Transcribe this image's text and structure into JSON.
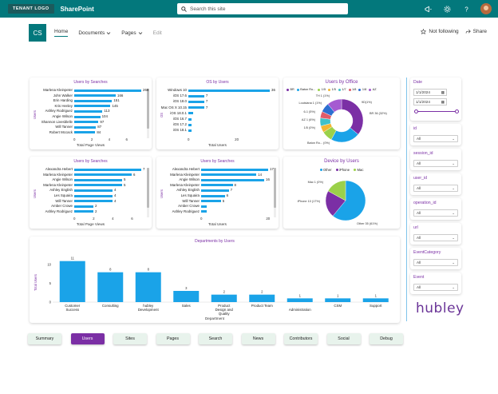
{
  "suite": {
    "tenant_logo": "TENANT LOGO",
    "app_name": "SharePoint",
    "search_placeholder": "Search this site"
  },
  "site": {
    "logo_initials": "CS",
    "nav": [
      "Home",
      "Documents",
      "Pages",
      "Edit"
    ],
    "not_following": "Not following",
    "share": "Share"
  },
  "card1": {
    "title": "Users by Searches",
    "y_title": "Users",
    "x_title": "Total Page Views",
    "ticks": [
      "0",
      "2",
      "4",
      "6"
    ],
    "rows": [
      {
        "label": "Marlena Kleinpeter",
        "value": "268",
        "v": 268
      },
      {
        "label": "John Walker",
        "value": "166",
        "v": 166
      },
      {
        "label": "Erin Harding",
        "value": "151",
        "v": 151
      },
      {
        "label": "Kris Henley",
        "value": "145",
        "v": 145
      },
      {
        "label": "Ashley Rodriguez",
        "value": "113",
        "v": 113
      },
      {
        "label": "Angie Wilson",
        "value": "104",
        "v": 104
      },
      {
        "label": "Shannon Livesblelle",
        "value": "97",
        "v": 97
      },
      {
        "label": "Will Tanner",
        "value": "87",
        "v": 87
      },
      {
        "label": "Robert Mccack",
        "value": "84",
        "v": 84
      }
    ]
  },
  "card2": {
    "title": "OS by Users",
    "y_title": "OS",
    "x_title": "Total Users",
    "ticks": [
      "0",
      "20"
    ],
    "rows": [
      {
        "label": "Windows 10",
        "value": "36",
        "v": 36
      },
      {
        "label": "iOS 17.6",
        "value": "7",
        "v": 7
      },
      {
        "label": "iOS 18.0",
        "value": "7",
        "v": 7
      },
      {
        "label": "Mac OS X 10.15",
        "value": "7",
        "v": 7
      },
      {
        "label": "iOS 18.0.1",
        "value": "",
        "v": 2
      },
      {
        "label": "iOS 16.7",
        "value": "",
        "v": 1.5
      },
      {
        "label": "iOS 17.2",
        "value": "",
        "v": 1.5
      },
      {
        "label": "iOS 18.1",
        "value": "",
        "v": 1.5
      }
    ]
  },
  "card3": {
    "title": "Users by Office",
    "legend": [
      "BR",
      "Baton Ro...",
      "1/5",
      "1/5",
      "1/7",
      "1/8",
      "1/8",
      "AZ"
    ],
    "legend_colors": [
      "#7b2fa5",
      "#1aa3e8",
      "#9bd14a",
      "#f2b632",
      "#3fc1c9",
      "#e05b6a",
      "#2d6fd1",
      "#a55bd1"
    ],
    "labels": [
      "TH 1 (1%)",
      "Louisiana 1 (1%)",
      "6-1 (5%)",
      "AZ 1 (6%)",
      "1/5 (0%)",
      "BR 36 (32%)",
      "Baton Ro... (0%)",
      "9D(1%)"
    ],
    "slices": [
      {
        "name": "BR",
        "v": 36,
        "color": "#7b2fa5"
      },
      {
        "name": "Baton Ro...",
        "v": 22,
        "color": "#1aa3e8"
      },
      {
        "name": "1/5",
        "v": 8,
        "color": "#9bd14a"
      },
      {
        "name": "1/5",
        "v": 5,
        "color": "#f2b632"
      },
      {
        "name": "1/7",
        "v": 6,
        "color": "#3fc1c9"
      },
      {
        "name": "1/8",
        "v": 5,
        "color": "#e05b6a"
      },
      {
        "name": "1/8",
        "v": 7,
        "color": "#2d6fd1"
      },
      {
        "name": "AZ",
        "v": 11,
        "color": "#a55bd1"
      }
    ]
  },
  "card4": {
    "title": "Users by Searches",
    "y_title": "Users",
    "x_title": "Total Page Views",
    "ticks": [
      "0",
      "2",
      "4",
      "6"
    ],
    "rows": [
      {
        "label": "Alexandra Hebert",
        "value": "7",
        "v": 7
      },
      {
        "label": "Marlena Kleinpeter",
        "value": "6",
        "v": 6
      },
      {
        "label": "Angie Wilson",
        "value": "5",
        "v": 5
      },
      {
        "label": "Marlena Kleinpeter",
        "value": "5",
        "v": 5
      },
      {
        "label": "Ashley English",
        "value": "4",
        "v": 4
      },
      {
        "label": "Les Squaira",
        "value": "4",
        "v": 4
      },
      {
        "label": "Will Tanner",
        "value": "4",
        "v": 4
      },
      {
        "label": "Amber Crowe",
        "value": "2",
        "v": 2
      },
      {
        "label": "Ashley Rodriguez",
        "value": "2",
        "v": 2
      }
    ]
  },
  "card5": {
    "title": "Users by Searches",
    "y_title": "Users",
    "x_title": "Total Users",
    "ticks": [
      "0",
      "20"
    ],
    "rows": [
      {
        "label": "Alexandra Hebert",
        "value": "17",
        "v": 17
      },
      {
        "label": "Marlena Kleinpeter",
        "value": "14",
        "v": 14
      },
      {
        "label": "Angie Wilson",
        "value": "16",
        "v": 16
      },
      {
        "label": "Marlena Kleinpeter",
        "value": "8",
        "v": 8
      },
      {
        "label": "Ashley English",
        "value": "7",
        "v": 7
      },
      {
        "label": "Les Squaira",
        "value": "6",
        "v": 6
      },
      {
        "label": "Will Tanner",
        "value": "5",
        "v": 5
      },
      {
        "label": "Amber Crowe",
        "value": "",
        "v": 1.5
      },
      {
        "label": "Ashley Rodriguez",
        "value": "",
        "v": 1.5
      }
    ]
  },
  "card6": {
    "title": "Device by Users",
    "legend": [
      "Other",
      "iPhone",
      "Mac"
    ],
    "legend_colors": [
      "#1aa3e8",
      "#7b2fa5",
      "#9bd14a"
    ],
    "labels": [
      "Mac 1 (0%)",
      "iPhone 10 (17%)",
      "Other 35 (61%)"
    ],
    "slices": [
      {
        "name": "Other",
        "v": 61,
        "color": "#1aa3e8"
      },
      {
        "name": "iPhone",
        "v": 22,
        "color": "#7b2fa5"
      },
      {
        "name": "Mac",
        "v": 17,
        "color": "#9bd14a"
      }
    ]
  },
  "card7": {
    "title": "Departments by Users",
    "y_title": "Total Users",
    "x_title": "Department",
    "ticks": [
      "0",
      "5",
      "10"
    ],
    "bars": [
      {
        "label": "Customer Success",
        "value": "11",
        "v": 11
      },
      {
        "label": "Consulting",
        "value": "8",
        "v": 8
      },
      {
        "label": "hubley Development",
        "value": "8",
        "v": 8
      },
      {
        "label": "Sales",
        "value": "3",
        "v": 3
      },
      {
        "label": "Product Design and Quality",
        "value": "2",
        "v": 2
      },
      {
        "label": "Product Team",
        "value": "2",
        "v": 2
      },
      {
        "label": "Administration",
        "value": "1",
        "v": 1
      },
      {
        "label": "CSM",
        "value": "1",
        "v": 1
      },
      {
        "label": "Support",
        "value": "1",
        "v": 1
      }
    ]
  },
  "filters": {
    "date_title": "Date",
    "date_from": "1/1/2024",
    "date_to": "1/1/2024",
    "slicers": [
      {
        "title": "id",
        "value": "All"
      },
      {
        "title": "session_id",
        "value": "All"
      },
      {
        "title": "user_id",
        "value": "All"
      },
      {
        "title": "operation_id",
        "value": "All"
      },
      {
        "title": "url",
        "value": "All"
      },
      {
        "title": "EventCategory",
        "value": "All"
      },
      {
        "title": "Event",
        "value": "All"
      }
    ]
  },
  "brand": "hubley",
  "bottom_nav": [
    "Summary",
    "Users",
    "Sites",
    "Pages",
    "Search",
    "News",
    "Contributors",
    "Social",
    "Debug"
  ],
  "chart_data": [
    {
      "type": "bar",
      "title": "Users by Searches",
      "xlabel": "Total Page Views",
      "ylabel": "Users",
      "categories": [
        "Marlena Kleinpeter",
        "John Walker",
        "Erin Harding",
        "Kris Henley",
        "Ashley Rodriguez",
        "Angie Wilson",
        "Shannon Livesblelle",
        "Will Tanner",
        "Robert Mccack"
      ],
      "values": [
        268,
        166,
        151,
        145,
        113,
        104,
        97,
        87,
        84
      ]
    },
    {
      "type": "bar",
      "title": "OS by Users",
      "xlabel": "Total Users",
      "ylabel": "OS",
      "categories": [
        "Windows 10",
        "iOS 17.6",
        "iOS 18.0",
        "Mac OS X 10.15",
        "iOS 18.0.1",
        "iOS 16.7",
        "iOS 17.2",
        "iOS 18.1"
      ],
      "values": [
        36,
        7,
        7,
        7,
        2,
        1.5,
        1.5,
        1.5
      ]
    },
    {
      "type": "pie",
      "title": "Users by Office",
      "categories": [
        "BR",
        "Baton Ro...",
        "1/5",
        "1/5",
        "1/7",
        "1/8",
        "1/8",
        "AZ"
      ],
      "values": [
        36,
        22,
        8,
        5,
        6,
        5,
        7,
        11
      ]
    },
    {
      "type": "bar",
      "title": "Users by Searches",
      "xlabel": "Total Page Views",
      "ylabel": "Users",
      "categories": [
        "Alexandra Hebert",
        "Marlena Kleinpeter",
        "Angie Wilson",
        "Marlena Kleinpeter",
        "Ashley English",
        "Les Squaira",
        "Will Tanner",
        "Amber Crowe",
        "Ashley Rodriguez"
      ],
      "values": [
        7,
        6,
        5,
        5,
        4,
        4,
        4,
        2,
        2
      ]
    },
    {
      "type": "bar",
      "title": "Users by Searches",
      "xlabel": "Total Users",
      "ylabel": "Users",
      "categories": [
        "Alexandra Hebert",
        "Marlena Kleinpeter",
        "Angie Wilson",
        "Marlena Kleinpeter",
        "Ashley English",
        "Les Squaira",
        "Will Tanner",
        "Amber Crowe",
        "Ashley Rodriguez"
      ],
      "values": [
        17,
        14,
        16,
        8,
        7,
        6,
        5,
        1.5,
        1.5
      ]
    },
    {
      "type": "pie",
      "title": "Device by Users",
      "categories": [
        "Other",
        "iPhone",
        "Mac"
      ],
      "values": [
        61,
        22,
        17
      ]
    },
    {
      "type": "bar",
      "title": "Departments by Users",
      "xlabel": "Department",
      "ylabel": "Total Users",
      "ylim": [
        0,
        12
      ],
      "categories": [
        "Customer Success",
        "Consulting",
        "hubley Development",
        "Sales",
        "Product Design and Quality",
        "Product Team",
        "Administration",
        "CSM",
        "Support"
      ],
      "values": [
        11,
        8,
        8,
        3,
        2,
        2,
        1,
        1,
        1
      ]
    }
  ]
}
